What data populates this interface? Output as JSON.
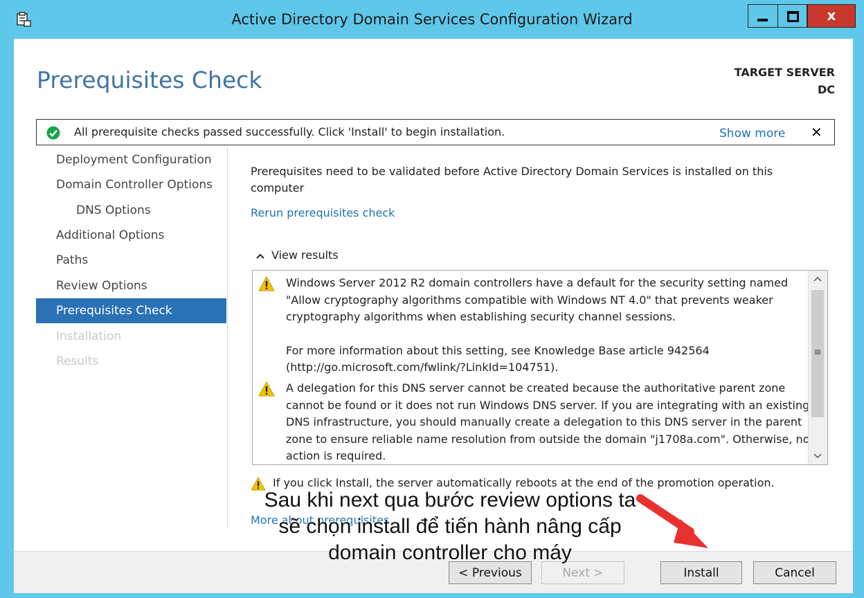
{
  "window": {
    "title": "Active Directory Domain Services Configuration Wizard",
    "close_glyph": "x"
  },
  "header": {
    "page_title": "Prerequisites Check",
    "target_label": "TARGET SERVER",
    "target_name": "DC"
  },
  "banner": {
    "message": "All prerequisite checks passed successfully.  Click 'Install' to begin installation.",
    "show_more": "Show more",
    "close_glyph": "✕"
  },
  "nav": {
    "items": [
      {
        "label": "Deployment Configuration",
        "state": "normal"
      },
      {
        "label": "Domain Controller Options",
        "state": "normal"
      },
      {
        "label": "DNS Options",
        "state": "normal"
      },
      {
        "label": "Additional Options",
        "state": "normal"
      },
      {
        "label": "Paths",
        "state": "normal"
      },
      {
        "label": "Review Options",
        "state": "normal"
      },
      {
        "label": "Prerequisites Check",
        "state": "selected"
      },
      {
        "label": "Installation",
        "state": "disabled"
      },
      {
        "label": "Results",
        "state": "disabled"
      }
    ]
  },
  "content": {
    "intro": "Prerequisites need to be validated before Active Directory Domain Services is installed on this computer",
    "rerun_link": "Rerun prerequisites check",
    "view_results": "View results",
    "results": [
      {
        "icon": "warning-icon",
        "paragraphs": [
          "Windows Server 2012 R2 domain controllers have a default for the security setting named \"Allow cryptography algorithms compatible with Windows NT 4.0\" that prevents weaker cryptography algorithms when establishing security channel sessions.",
          "For more information about this setting, see Knowledge Base article 942564 (http://go.microsoft.com/fwlink/?LinkId=104751)."
        ]
      },
      {
        "icon": "warning-icon",
        "paragraphs": [
          "A delegation for this DNS server cannot be created because the authoritative parent zone cannot be found or it does not run Windows DNS server. If you are integrating with an existing DNS infrastructure, you should manually create a delegation to this DNS server in the parent zone to ensure reliable name resolution from outside the domain \"j1708a.com\". Otherwise, no action is required."
        ]
      }
    ],
    "reboot_warning": "If you click Install, the server automatically reboots at the end of the promotion operation.",
    "more_link": "More about prerequisites"
  },
  "footer": {
    "previous": "< Previous",
    "next": "Next >",
    "install": "Install",
    "cancel": "Cancel"
  },
  "annotation": {
    "lines": [
      "Sau khi next qua bước review options ta",
      "sẽ chọn install để tiến hành nâng cấp",
      "domain controller cho máy"
    ],
    "arrow_color": "#e8312f"
  },
  "colors": {
    "titlebar": "#5ec7ea",
    "accent": "#2a71b5",
    "link": "#1f73b7",
    "success": "#1aa34a",
    "warning": "#f2c200",
    "close_button": "#c8382c"
  }
}
